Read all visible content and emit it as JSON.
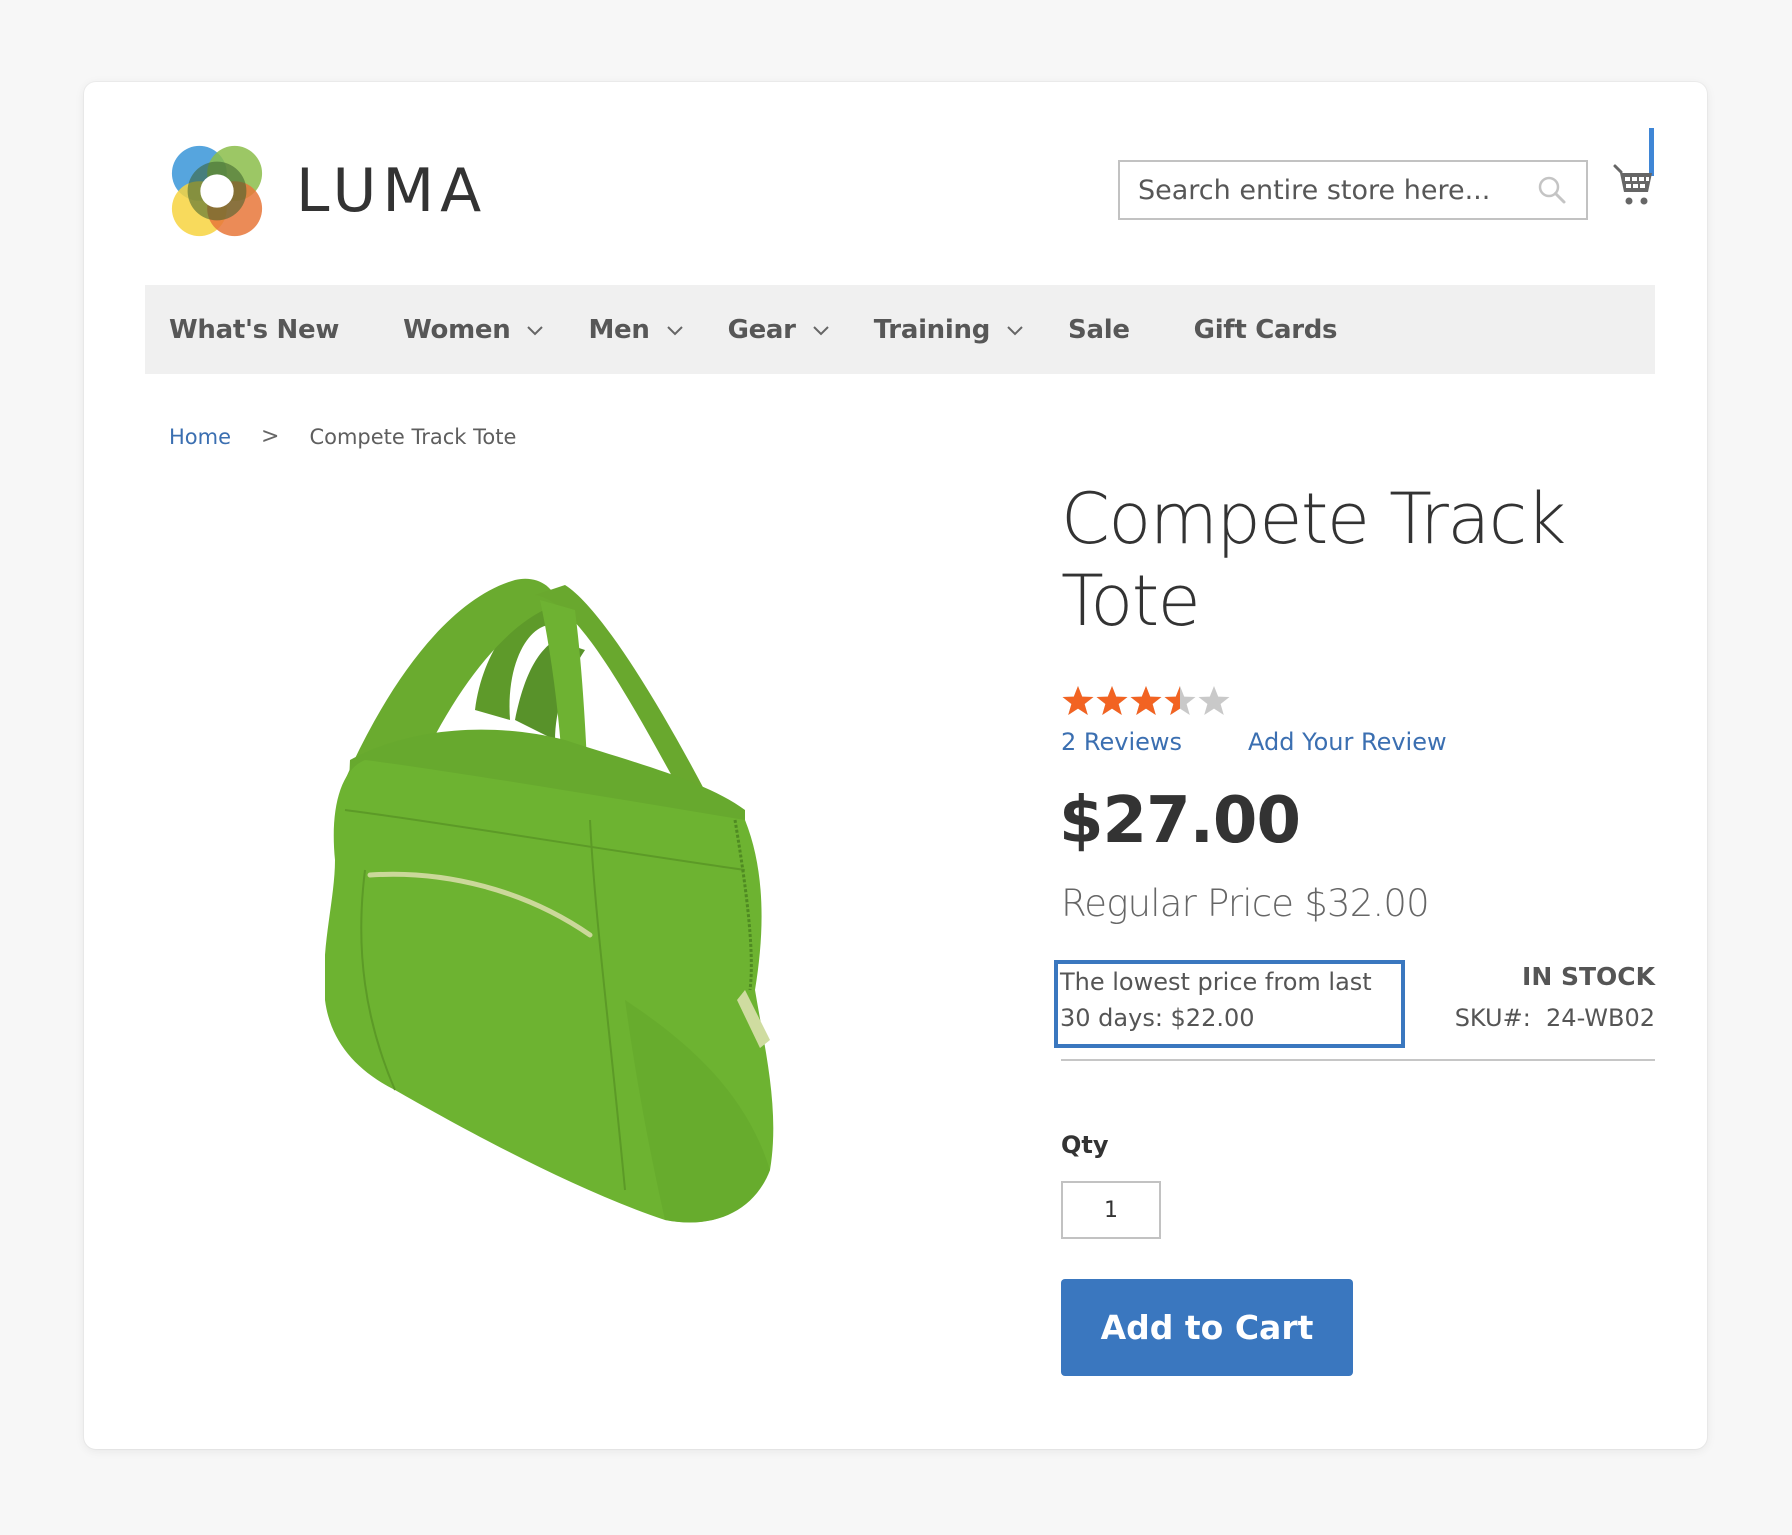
{
  "header": {
    "logo_text": "LUMA",
    "search": {
      "placeholder": "Search entire store here...",
      "value": ""
    },
    "cart_icon": "shopping-cart-icon",
    "search_icon": "magnifier-icon"
  },
  "nav": {
    "items": [
      {
        "label": "What's New",
        "has_submenu": false
      },
      {
        "label": "Women",
        "has_submenu": true
      },
      {
        "label": "Men",
        "has_submenu": true
      },
      {
        "label": "Gear",
        "has_submenu": true
      },
      {
        "label": "Training",
        "has_submenu": true
      },
      {
        "label": "Sale",
        "has_submenu": false
      },
      {
        "label": "Gift Cards",
        "has_submenu": false
      }
    ]
  },
  "breadcrumb": {
    "home": "Home",
    "separator": ">",
    "current": "Compete Track Tote"
  },
  "product": {
    "title": "Compete Track Tote",
    "image_alt": "Green tote bag",
    "rating": {
      "value": 3.5,
      "max": 5
    },
    "reviews_label": "2  Reviews",
    "add_review_label": "Add Your Review",
    "price": "$27.00",
    "regular_price": "Regular Price $32.00",
    "lowest_price_note": "The lowest price from last 30 days: $22.00",
    "stock": "IN STOCK",
    "sku": "SKU#:  24-WB02",
    "qty_label": "Qty",
    "qty_value": "1",
    "add_to_cart_label": "Add to Cart"
  },
  "colors": {
    "accent": "#3a77bf",
    "link": "#3b6fb1",
    "star_filled": "#f26322",
    "star_empty": "#c9c9c9",
    "nav_bg": "#f0f0f0",
    "page_bg": "#f7f7f7"
  }
}
